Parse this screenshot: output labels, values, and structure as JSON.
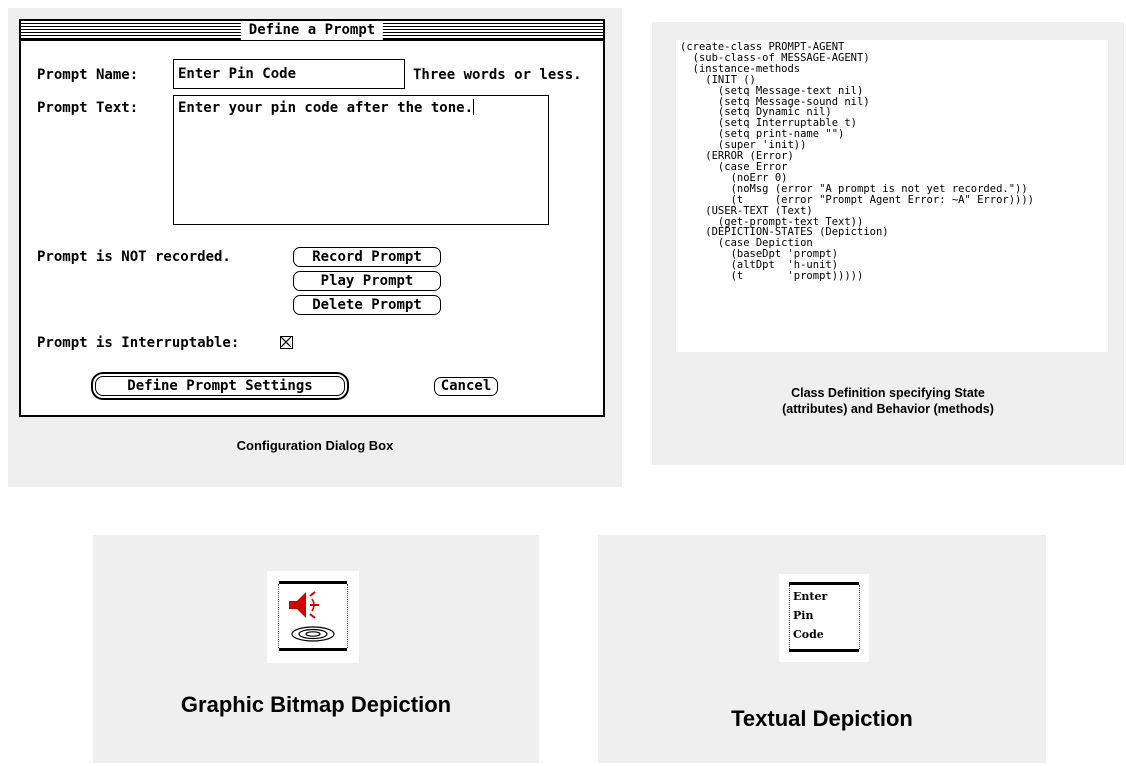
{
  "dialog": {
    "title": "Define a Prompt",
    "prompt_name_label": "Prompt Name:",
    "prompt_name_value": "Enter Pin Code",
    "prompt_name_hint": "Three words or less.",
    "prompt_text_label": "Prompt Text:",
    "prompt_text_value": "Enter your pin code after the tone.",
    "record_status": "Prompt is NOT recorded.",
    "buttons": {
      "record": "Record Prompt",
      "play": "Play Prompt",
      "delete": "Delete Prompt",
      "define": "Define Prompt Settings",
      "cancel": "Cancel"
    },
    "interruptable_label": "Prompt is Interruptable:",
    "interruptable_checked": true
  },
  "captions": {
    "dialog": "Configuration Dialog Box",
    "code_line1": "Class Definition specifying State",
    "code_line2": "(attributes)  and Behavior (methods)",
    "graphic": "Graphic Bitmap Depiction",
    "textual": "Textual  Depiction"
  },
  "code_listing": "(create-class PROMPT-AGENT\n  (sub-class-of MESSAGE-AGENT)\n  (instance-methods\n    (INIT ()\n      (setq Message-text nil)\n      (setq Message-sound nil)\n      (setq Dynamic nil)\n      (setq Interruptable t)\n      (setq print-name \"\")\n      (super 'init))\n    (ERROR (Error)\n      (case Error\n        (noErr 0)\n        (noMsg (error \"A prompt is not yet recorded.\"))\n        (t     (error \"Prompt Agent Error: ~A\" Error))))\n    (USER-TEXT (Text)\n      (get-prompt-text Text))\n    (DEPICTION-STATES (Depiction)\n      (case Depiction\n        (baseDpt 'prompt)\n        (altDpt  'h-unit)\n        (t       'prompt)))))",
  "textual_icon_words": [
    "Enter",
    "Pin",
    "Code"
  ],
  "icons": {
    "graphic": "speaker-sound-icon",
    "cassette": "tape-reel-icon"
  },
  "colors": {
    "panel_bg": "#efefef",
    "speaker_red": "#d40000"
  }
}
